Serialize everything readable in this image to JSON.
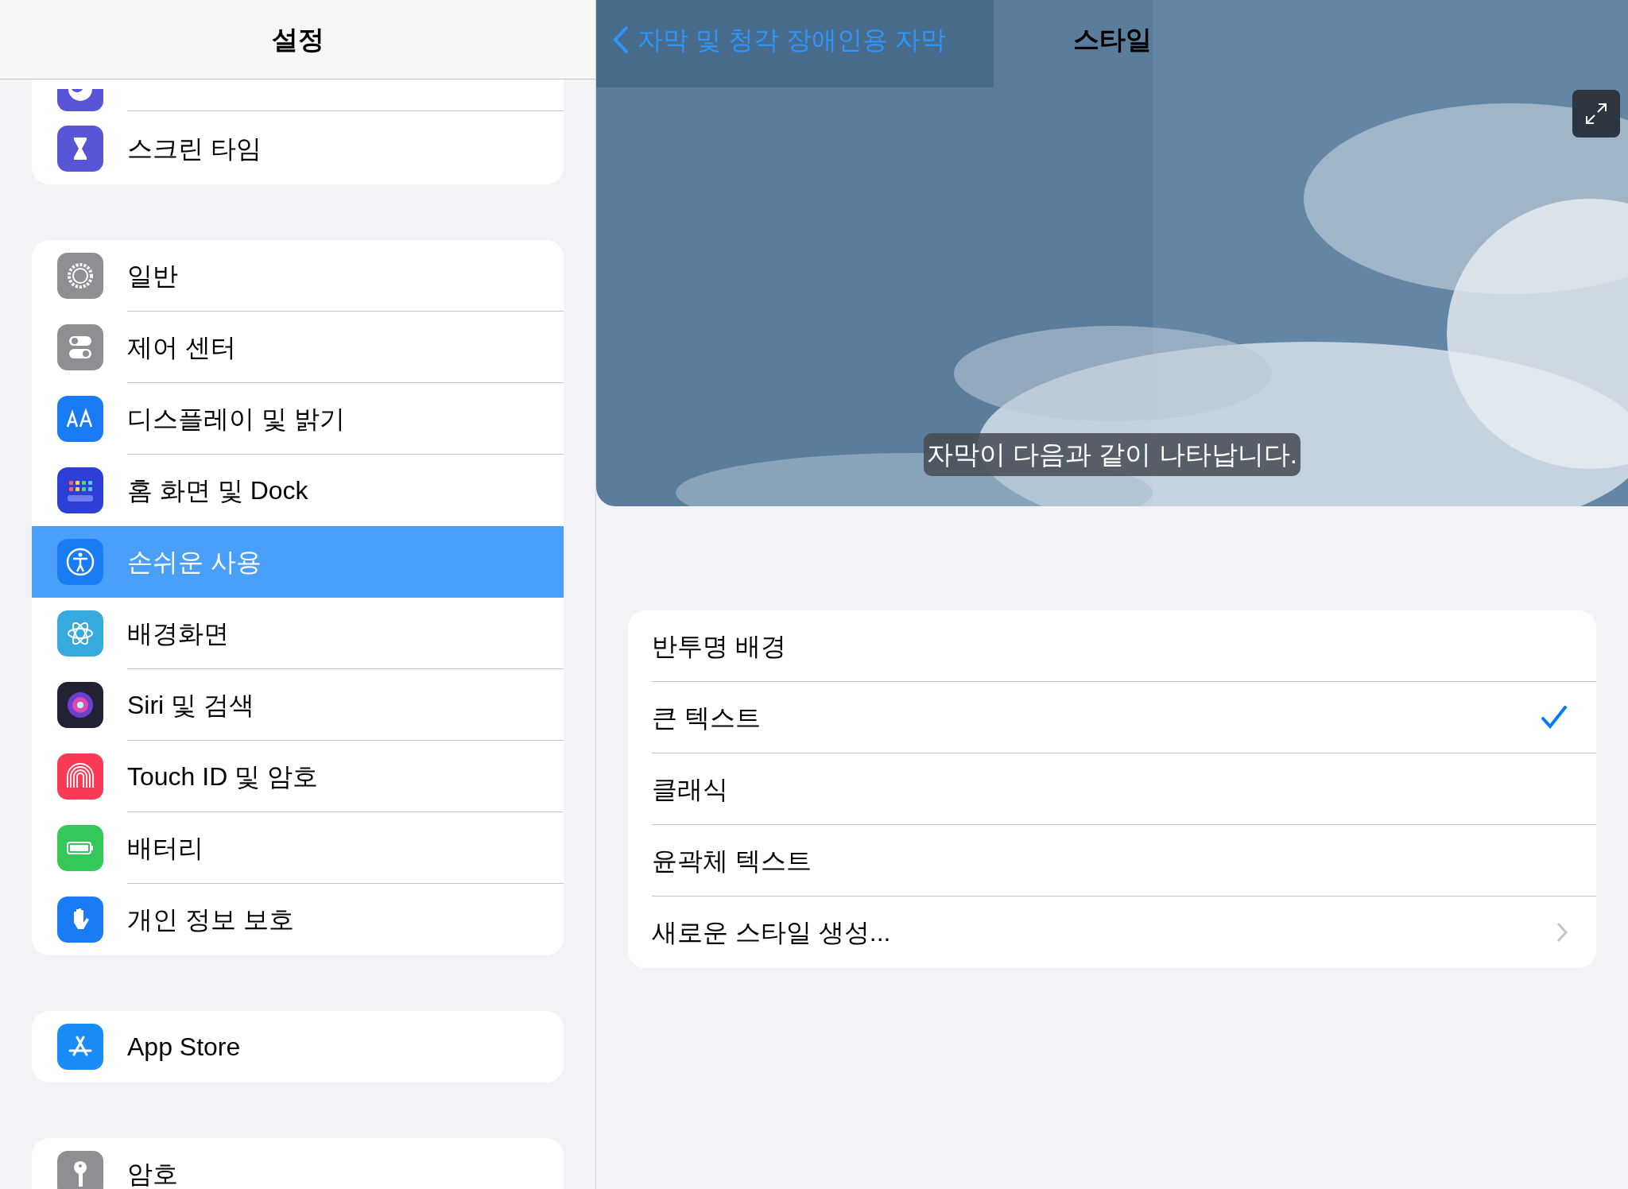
{
  "sidebar": {
    "title": "설정",
    "groups": [
      {
        "items": [
          {
            "color": "#5856d6",
            "selected": false
          },
          {
            "label": "스크린 타임",
            "color": "#5856d6",
            "selected": false
          }
        ]
      },
      {
        "items": [
          {
            "label": "일반",
            "color": "#8e8e93",
            "selected": false
          },
          {
            "label": "제어 센터",
            "color": "#8e8e93",
            "selected": false
          },
          {
            "label": "디스플레이 및 밝기",
            "color": "#1a7cf5",
            "selected": false
          },
          {
            "label": "홈 화면 및 Dock",
            "color": "#2c3fd6",
            "selected": false
          },
          {
            "label": "손쉬운 사용",
            "color": "#1a7cf5",
            "selected": true
          },
          {
            "label": "배경화면",
            "color": "#36aadc",
            "selected": false
          },
          {
            "label": "Siri 및 검색",
            "color": "#222235",
            "selected": false
          },
          {
            "label": "Touch ID 및 암호",
            "color": "#fa3b55",
            "selected": false
          },
          {
            "label": "배터리",
            "color": "#34c759",
            "selected": false
          },
          {
            "label": "개인 정보 보호",
            "color": "#1a7cf5",
            "selected": false
          }
        ]
      },
      {
        "items": [
          {
            "label": "App Store",
            "color": "#1a8cf8",
            "selected": false
          }
        ]
      },
      {
        "items": [
          {
            "label": "암호",
            "color": "#8e8e93",
            "selected": false
          }
        ]
      }
    ]
  },
  "detail": {
    "back": "자막 및 청각 장애인용 자막",
    "title": "스타일",
    "preview": {
      "kind": "picture",
      "caption": "자막이 다음과 같이 나타납니다."
    },
    "options": [
      {
        "label": "반투명 배경",
        "kind": "option",
        "selected": false
      },
      {
        "label": "큰 텍스트",
        "kind": "option",
        "selected": true
      },
      {
        "label": "클래식",
        "kind": "option",
        "selected": false
      },
      {
        "label": "윤곽체 텍스트",
        "kind": "option",
        "selected": false
      },
      {
        "label": "새로운 스타일 생성...",
        "kind": "link"
      }
    ]
  }
}
